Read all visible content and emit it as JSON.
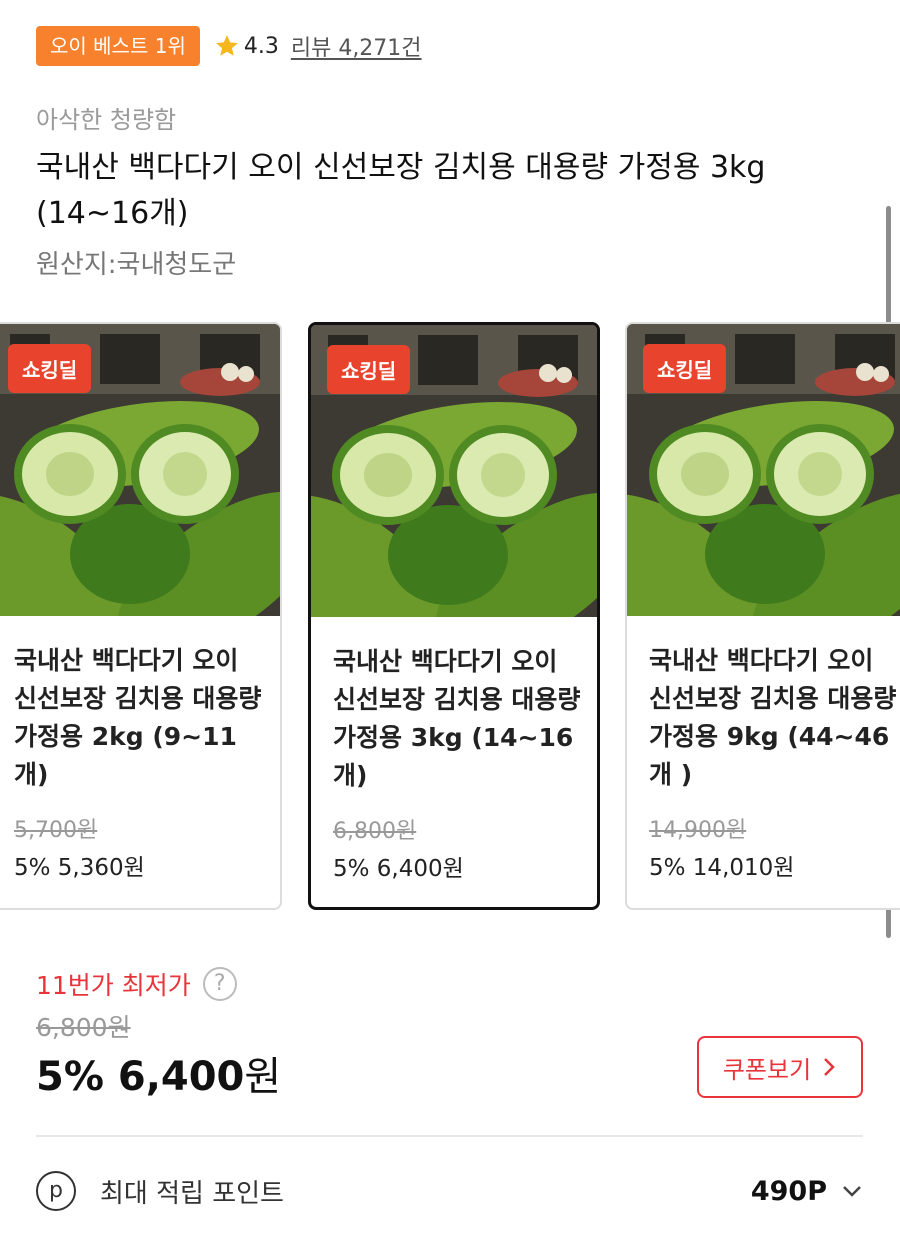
{
  "header": {
    "best_badge": "오이 베스트 1위",
    "rating": "4.3",
    "review_label": "리뷰 4,271건"
  },
  "product": {
    "subtitle": "아삭한 청량함",
    "title": "국내산 백다다기 오이 신선보장 김치용 대용량 가정용 3kg (14~16개)",
    "origin": "원산지:국내청도군"
  },
  "options": [
    {
      "badge": "쇼킹딜",
      "name": "국내산 백다다기 오이 신선보장 김치용 대용량 가정용 2kg (9~11개)",
      "original_price": "5,700원",
      "price": "5% 5,360원",
      "selected": false
    },
    {
      "badge": "쇼킹딜",
      "name": "국내산 백다다기 오이 신선보장 김치용 대용량 가정용 3kg (14~16개)",
      "original_price": "6,800원",
      "price": "5% 6,400원",
      "selected": true
    },
    {
      "badge": "쇼킹딜",
      "name": "국내산 백다다기 오이 신선보장 김치용 대용량 가정용 9kg (44~46개 )",
      "original_price": "14,900원",
      "price": "5% 14,010원",
      "selected": false
    }
  ],
  "pricing": {
    "lowest_label": "11번가 최저가",
    "help_icon": "?",
    "original_price": "6,800원",
    "discount": "5%",
    "final_amount": "6,400",
    "final_unit": "원",
    "coupon_label": "쿠폰보기"
  },
  "points": {
    "icon_glyph": "p",
    "label": "최대 적립 포인트",
    "value": "490P"
  },
  "colors": {
    "best_badge": "#f7812c",
    "deal_badge": "#e8432c",
    "accent_red": "#e8343a"
  },
  "icons": [
    "star-icon",
    "help-icon",
    "chevron-right-icon",
    "point-icon",
    "chevron-down-icon"
  ]
}
